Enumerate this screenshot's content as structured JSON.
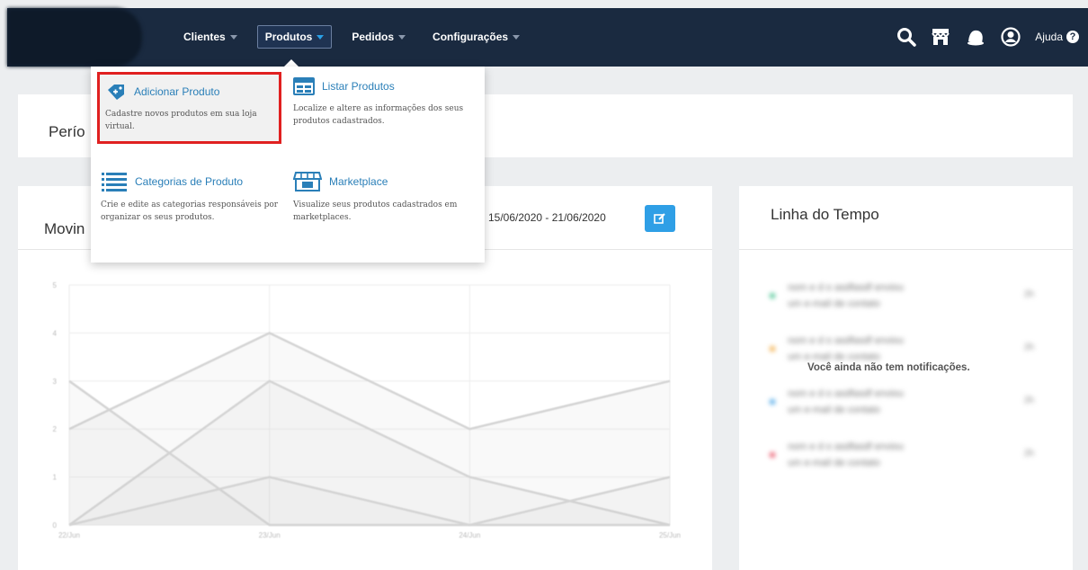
{
  "nav": {
    "items": [
      {
        "label": "Clientes"
      },
      {
        "label": "Produtos"
      },
      {
        "label": "Pedidos"
      },
      {
        "label": "Configurações"
      }
    ],
    "help_label": "Ajuda",
    "help_glyph": "?",
    "icons": [
      "search-icon",
      "store-icon",
      "bell-icon",
      "user-icon"
    ]
  },
  "dropdown": {
    "items": [
      {
        "title": "Adicionar Produto",
        "description": "Cadastre novos produtos em sua loja virtual.",
        "icon": "add-product-icon"
      },
      {
        "title": "Listar Produtos",
        "description": "Localize e altere as informações dos seus produtos cadastrados.",
        "icon": "list-products-icon"
      },
      {
        "title": "Categorias de Produto",
        "description": "Crie e edite as categorias responsáveis por organizar os seus produtos.",
        "icon": "categories-icon"
      },
      {
        "title": "Marketplace",
        "description": "Visualize seus produtos cadastrados em marketplaces.",
        "icon": "marketplace-icon"
      }
    ]
  },
  "period": {
    "label": "Perío"
  },
  "movement": {
    "title": "Movin",
    "date_range": "15/06/2020 - 21/06/2020"
  },
  "timeline": {
    "title": "Linha do Tempo",
    "empty_message": "Você ainda não tem notificações.",
    "notifications": [
      {
        "line1": "nom e d o asdfasdf enviou",
        "line2": "um e-mail de contato",
        "time": "2h",
        "color": "#3cc08a"
      },
      {
        "line1": "nom e d o asdfasdf enviou",
        "line2": "um e-mail de contato",
        "time": "2h",
        "color": "#f2a83a"
      },
      {
        "line1": "nom e d o asdfasdf enviou",
        "line2": "um e-mail de contato",
        "time": "2h",
        "color": "#3c9fe6"
      },
      {
        "line1": "nom e d o asdfasdf enviou",
        "line2": "um e-mail de contato",
        "time": "2h",
        "color": "#e84a5f"
      }
    ]
  },
  "chart_data": {
    "type": "line",
    "categories": [
      "22/Jun",
      "23/Jun",
      "24/Jun",
      "25/Jun"
    ],
    "ylim": [
      0,
      5
    ],
    "yticks": [
      "0",
      "1",
      "2",
      "3",
      "4",
      "5"
    ],
    "series": [
      {
        "values": [
          2,
          4,
          2,
          3
        ]
      },
      {
        "values": [
          0,
          3,
          1,
          0
        ]
      },
      {
        "values": [
          3,
          0,
          0,
          0
        ]
      },
      {
        "values": [
          0,
          1,
          0,
          1
        ]
      }
    ],
    "grid": true
  },
  "colors": {
    "topbar": "#1a2a40",
    "accent": "#2f9fe6",
    "highlight_border": "#e02020",
    "link": "#2a7fb8"
  }
}
